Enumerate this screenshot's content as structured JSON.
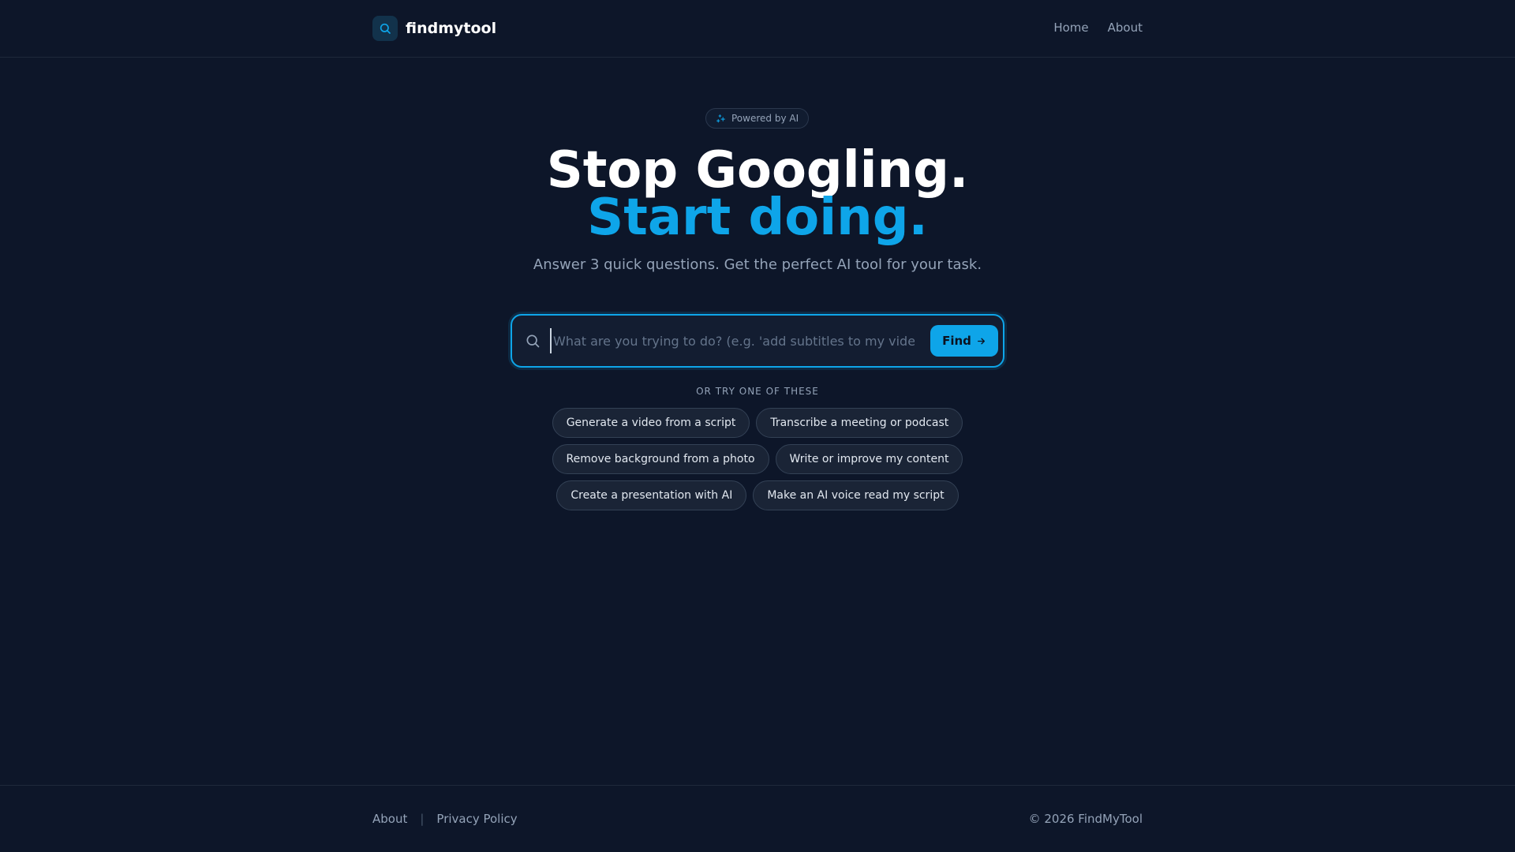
{
  "header": {
    "logo_icon": "search-icon",
    "logo_text": "findmytool",
    "nav": [
      "Home",
      "About"
    ]
  },
  "hero": {
    "badge_icon": "sparkles-icon",
    "badge": "Powered by AI",
    "title_line1": "Stop Googling.",
    "title_line2": "Start doing.",
    "subtitle": "Answer 3 quick questions. Get the perfect AI tool for your task."
  },
  "search": {
    "icon": "search-icon",
    "placeholder": "What are you trying to do? (e.g. 'add subtitles to my video')",
    "value": "",
    "button_label": "Find",
    "button_icon": "arrow-right-icon"
  },
  "suggestions": {
    "label": "OR TRY ONE OF THESE",
    "items": [
      "Generate a video from a script",
      "Transcribe a meeting or podcast",
      "Remove background from a photo",
      "Write or improve my content",
      "Create a presentation with AI",
      "Make an AI voice read my script"
    ]
  },
  "footer": {
    "links": [
      "About",
      "Privacy Policy"
    ],
    "separator": "|",
    "copyright": "© 2026 FindMyTool"
  },
  "colors": {
    "background": "#0d1629",
    "accent": "#0ea5e9",
    "text": "#ffffff",
    "muted": "#94a3b8"
  }
}
